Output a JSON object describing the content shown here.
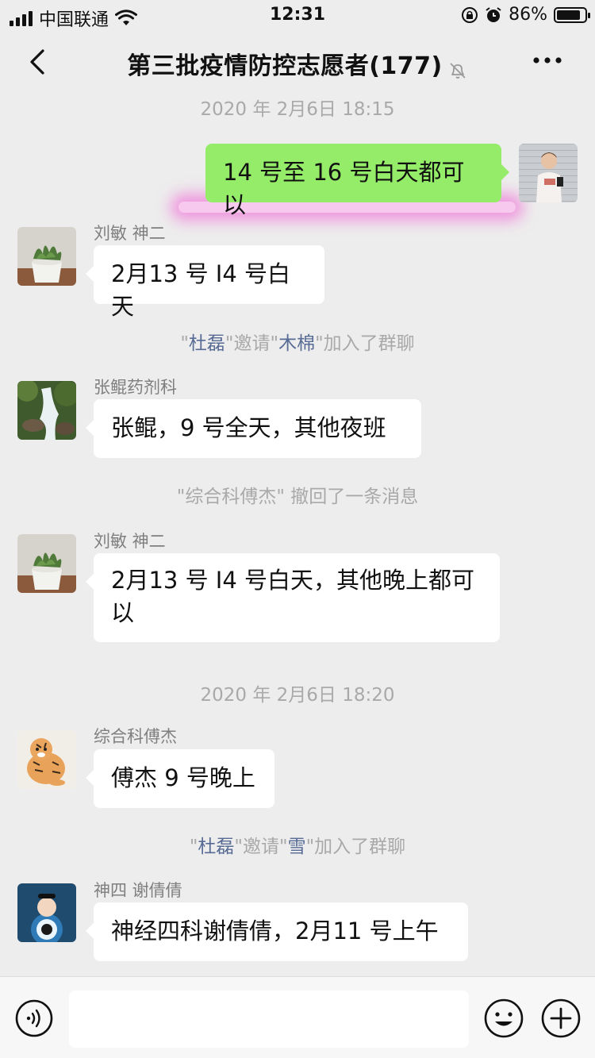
{
  "status_bar": {
    "carrier": "中国联通",
    "time": "12:31",
    "battery_percent": "86%",
    "battery_level": 0.86,
    "icons": [
      "signal-icon",
      "wifi-icon",
      "lock-rotation-icon",
      "alarm-icon",
      "battery-icon"
    ]
  },
  "header": {
    "title": "第三批疫情防控志愿者(177)",
    "icons": [
      "back-icon",
      "mute-icon",
      "more-icon"
    ]
  },
  "messages": [
    {
      "type": "timestamp",
      "text": "2020 年 2月6日 18:15"
    },
    {
      "type": "outgoing",
      "text": "14 号至 16 号白天都可以",
      "avatar": "boy-photo"
    },
    {
      "type": "incoming",
      "sender": "刘敏  神二",
      "text": "2月13 号 I4 号白天",
      "avatar": "succulent-plant"
    },
    {
      "type": "system",
      "parts": [
        "\"",
        "杜磊",
        "\"邀请\"",
        "木棉",
        "\"加入了群聊"
      ]
    },
    {
      "type": "incoming",
      "sender": "张鲲药剂科",
      "text": "张鲲，9 号全天，其他夜班",
      "avatar": "waterfall-photo"
    },
    {
      "type": "system",
      "text": "\"综合科傅杰\" 撤回了一条消息"
    },
    {
      "type": "incoming",
      "sender": "刘敏  神二",
      "text": "2月13 号 I4 号白天，其他晚上都可以",
      "avatar": "succulent-plant"
    },
    {
      "type": "timestamp",
      "text": "2020 年 2月6日 18:20"
    },
    {
      "type": "incoming",
      "sender": "综合科傅杰",
      "text": "傅杰 9 号晚上",
      "avatar": "tiger-drawing"
    },
    {
      "type": "system",
      "parts": [
        "\"",
        "杜磊",
        "\"邀请\"",
        "雪",
        "\"加入了群聊"
      ]
    },
    {
      "type": "incoming",
      "sender": "神四  谢倩倩",
      "text": "神经四科谢倩倩，2月11 号上午",
      "avatar": "cartoon-avatar"
    }
  ],
  "input_bar": {
    "placeholder": "",
    "icons": [
      "voice-icon",
      "emoji-icon",
      "plus-icon"
    ]
  },
  "colors": {
    "background": "#ededed",
    "outgoing_bubble": "#95ec69",
    "incoming_bubble": "#ffffff",
    "system_name": "#576b95",
    "meta_text": "#a9a9a9",
    "highlight": "#f050d2"
  }
}
